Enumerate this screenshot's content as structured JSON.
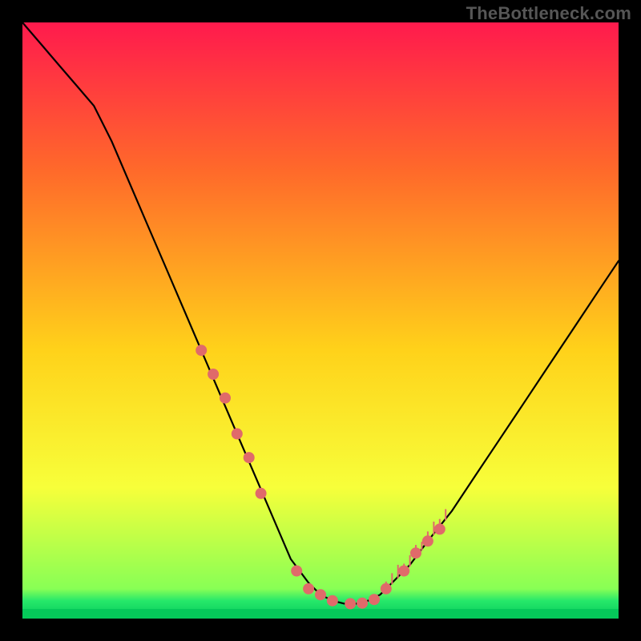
{
  "watermark": "TheBottleneck.com",
  "chart_data": {
    "type": "line",
    "title": "",
    "xlabel": "",
    "ylabel": "",
    "xlim": [
      0,
      100
    ],
    "ylim": [
      0,
      100
    ],
    "grid": false,
    "legend": false,
    "series": [
      {
        "name": "bottleneck-curve",
        "x": [
          0,
          3,
          6,
          9,
          12,
          15,
          18,
          21,
          24,
          27,
          30,
          33,
          36,
          39,
          42,
          45,
          48,
          50,
          52,
          54,
          56,
          58,
          60,
          62,
          65,
          68,
          72,
          76,
          80,
          84,
          88,
          92,
          96,
          100
        ],
        "y": [
          100,
          96.5,
          93,
          89.5,
          86,
          80,
          73,
          66,
          59,
          52,
          45,
          38,
          31,
          24,
          17,
          10,
          6,
          4,
          3,
          2.5,
          2.5,
          3,
          4,
          6,
          9,
          13,
          18,
          24,
          30,
          36,
          42,
          48,
          54,
          60
        ]
      }
    ],
    "markers": {
      "name": "highlighted-points",
      "color": "#e06a6a",
      "x": [
        30,
        32,
        34,
        36,
        38,
        40,
        46,
        48,
        50,
        52,
        55,
        57,
        59,
        61,
        64,
        66,
        68,
        70
      ],
      "y": [
        45,
        41,
        37,
        31,
        27,
        21,
        8,
        5,
        4,
        3,
        2.5,
        2.6,
        3.2,
        5,
        8,
        11,
        13,
        15
      ]
    },
    "ticks": {
      "name": "tick-cluster",
      "color": "#e06a6a",
      "x": [
        61,
        62,
        63,
        64,
        65,
        66,
        67,
        68,
        69,
        70,
        71
      ],
      "height": 2
    },
    "gradient_stops": [
      {
        "offset": 0.0,
        "color": "#ff1a4d"
      },
      {
        "offset": 0.25,
        "color": "#ff6a2a"
      },
      {
        "offset": 0.55,
        "color": "#ffd21a"
      },
      {
        "offset": 0.78,
        "color": "#f7ff3a"
      },
      {
        "offset": 0.95,
        "color": "#88ff55"
      },
      {
        "offset": 0.97,
        "color": "#26e86a"
      },
      {
        "offset": 1.0,
        "color": "#05c95a"
      }
    ]
  }
}
